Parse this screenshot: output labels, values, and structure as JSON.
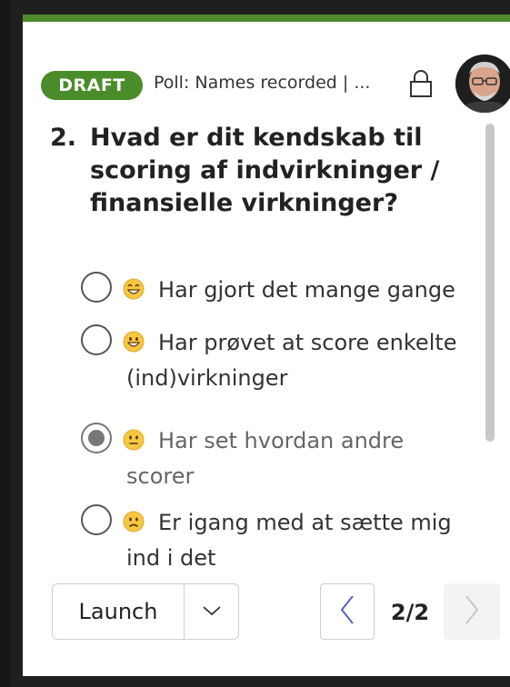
{
  "header": {
    "status_badge": "DRAFT",
    "poll_title": "Poll: Names recorded | ...",
    "lock_icon": "lock-icon",
    "avatar_icon": "user-avatar"
  },
  "question": {
    "number": "2.",
    "text": "Hvad er dit kendskab til scoring af indvirkninger / finansielle virkninger?"
  },
  "options": [
    {
      "emoji": "grinning-face-smiling-eyes",
      "label": "Har gjort det mange gange",
      "selected": false
    },
    {
      "emoji": "grinning-face",
      "label": "Har prøvet at score enkelte (ind)virkninger",
      "selected": false
    },
    {
      "emoji": "neutral-face",
      "label": "Har set hvordan andre scorer",
      "selected": true
    },
    {
      "emoji": "slightly-frowning-face",
      "label": "Er igang med at sætte mig ind i det",
      "selected": false
    }
  ],
  "footer": {
    "launch_label": "Launch",
    "dropdown_icon": "chevron-down-icon",
    "prev_icon": "chevron-left-icon",
    "page_indicator": "2/2",
    "next_icon": "chevron-right-icon"
  },
  "colors": {
    "accent_green": "#4a8c2a",
    "prev_arrow": "#5b5fc7",
    "text_dark": "#222222"
  }
}
